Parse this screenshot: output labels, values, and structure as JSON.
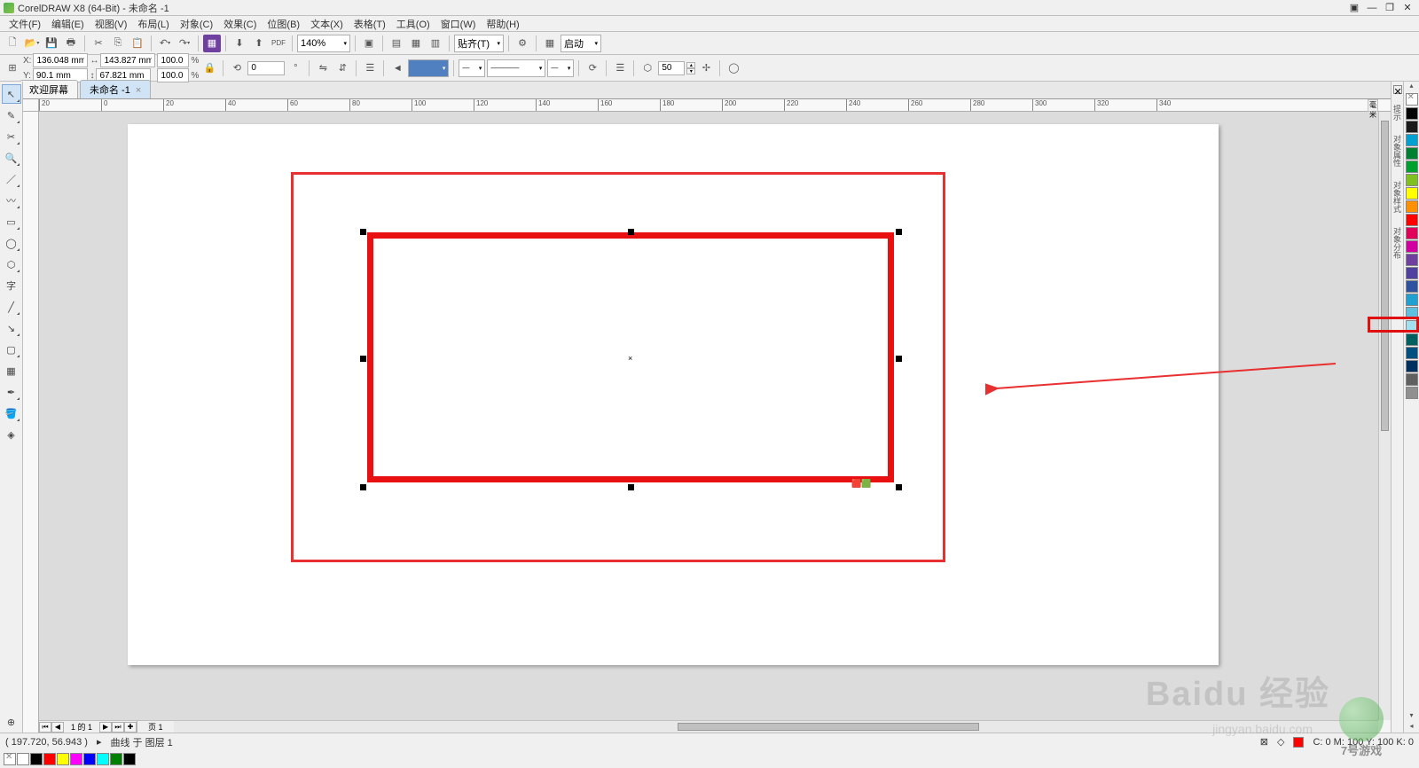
{
  "title": "CorelDRAW X8 (64-Bit) - 未命名 -1",
  "menu": [
    "文件(F)",
    "编辑(E)",
    "视图(V)",
    "布局(L)",
    "对象(C)",
    "效果(C)",
    "位图(B)",
    "文本(X)",
    "表格(T)",
    "工具(O)",
    "窗口(W)",
    "帮助(H)"
  ],
  "toolbar1": {
    "zoom": "140%",
    "pdf_label": "PDF",
    "snap_label": "贴齐(T)",
    "start_label": "启动"
  },
  "propbar": {
    "x_label": "X:",
    "y_label": "Y:",
    "x": "136.048 mm",
    "y": "90.1 mm",
    "w": "143.827 mm",
    "h": "67.821 mm",
    "sx": "100.0",
    "sy": "100.0",
    "pct": "%",
    "rotate": "0",
    "chevron": "»",
    "outline_value": "50"
  },
  "tabs": {
    "welcome": "欢迎屏幕",
    "untitled": "未命名 -1"
  },
  "ruler_ticks": [
    "20",
    "0",
    "20",
    "40",
    "60",
    "80",
    "100",
    "120",
    "140",
    "160",
    "180",
    "200",
    "220",
    "240",
    "260",
    "280",
    "300",
    "320",
    "340"
  ],
  "page_nav": {
    "info": "1 的 1",
    "page_tab": "页 1"
  },
  "status": {
    "coords": "( 197.720, 56.943 )",
    "arrow": "▸",
    "object": "曲线 于 图层 1",
    "color": "C: 0 M: 100 Y: 100 K: 0"
  },
  "palette": {
    "colors": [
      "#000000",
      "#1a1a1a",
      "#00a0d0",
      "#008030",
      "#00a030",
      "#80c020",
      "#ffff00",
      "#ff9000",
      "#ff0000",
      "#e0005a",
      "#d000a0",
      "#7040a0",
      "#5040a0",
      "#3050a0",
      "#20a0d0",
      "#60c0e0",
      "#a0e0f0",
      "#006060",
      "#005080",
      "#003060",
      "#606060",
      "#909090"
    ],
    "bottom": [
      "#ffffff",
      "#000000",
      "#ff0000",
      "#ffff00",
      "#ff00ff",
      "#0000ff",
      "#00ffff",
      "#008000",
      "#000000"
    ]
  },
  "right_tabs": [
    "提示",
    "对象属性",
    "对象样式",
    "对象分布"
  ],
  "annotations": {
    "red_highlight": true
  },
  "watermark": {
    "main": "Baidu 经验",
    "url": "jingyan.baidu.com",
    "corner": "7号游戏"
  }
}
